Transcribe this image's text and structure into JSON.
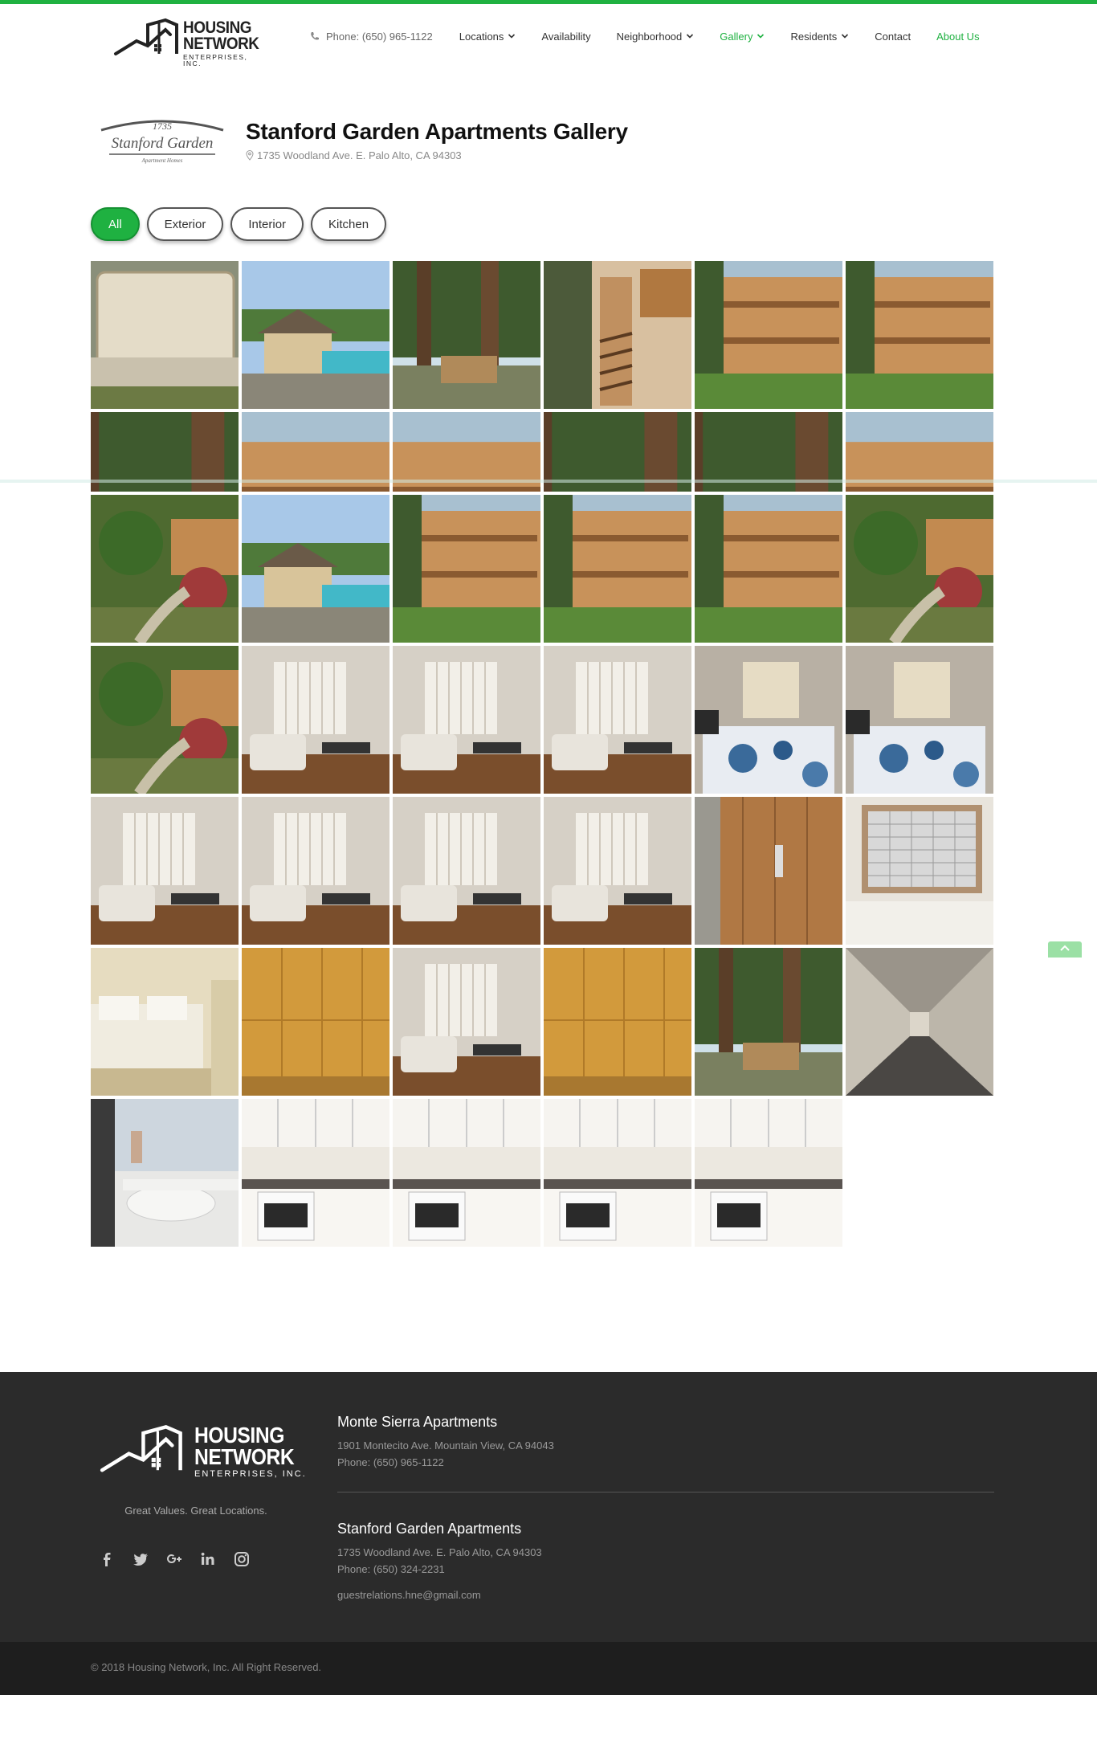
{
  "header": {
    "brand": {
      "line1": "HOUSING",
      "line2": "NETWORK",
      "line3": "ENTERPRISES, INC."
    },
    "phone": "Phone: (650) 965-1122",
    "nav": [
      {
        "label": "Locations",
        "dropdown": true,
        "active": false
      },
      {
        "label": "Availability",
        "dropdown": false,
        "active": false
      },
      {
        "label": "Neighborhood",
        "dropdown": true,
        "active": false
      },
      {
        "label": "Gallery",
        "dropdown": true,
        "active": true
      },
      {
        "label": "Residents",
        "dropdown": true,
        "active": false
      },
      {
        "label": "Contact",
        "dropdown": false,
        "active": false
      },
      {
        "label": "About Us",
        "dropdown": false,
        "active": true
      }
    ],
    "accent_color": "#1fb141"
  },
  "property": {
    "logo": {
      "number": "1735",
      "name": "Stanford Garden",
      "sub": "Apartment Homes"
    },
    "title": "Stanford Garden Apartments Gallery",
    "address": "1735 Woodland Ave. E. Palo Alto, CA 94303"
  },
  "filters": [
    {
      "label": "All",
      "active": true
    },
    {
      "label": "Exterior",
      "active": false
    },
    {
      "label": "Interior",
      "active": false
    },
    {
      "label": "Kitchen",
      "active": false
    }
  ],
  "gallery": {
    "photos": [
      {
        "name": "sign",
        "theme": "sign"
      },
      {
        "name": "pool-gazebo",
        "theme": "pool"
      },
      {
        "name": "courtyard-trees",
        "theme": "trees"
      },
      {
        "name": "stairs",
        "theme": "stairs"
      },
      {
        "name": "building-balconies",
        "theme": "building"
      },
      {
        "name": "building-balconies-2",
        "theme": "building"
      },
      {
        "name": "tall-trees",
        "theme": "trees"
      },
      {
        "name": "building-redwood",
        "theme": "building"
      },
      {
        "name": "balconies-redwood",
        "theme": "building"
      },
      {
        "name": "walkway-trees",
        "theme": "trees"
      },
      {
        "name": "courtyard-green",
        "theme": "trees"
      },
      {
        "name": "building-corner",
        "theme": "building"
      },
      {
        "name": "garden-path",
        "theme": "garden"
      },
      {
        "name": "pool-umbrellas",
        "theme": "pool"
      },
      {
        "name": "building-sky",
        "theme": "building"
      },
      {
        "name": "carport-walk",
        "theme": "building"
      },
      {
        "name": "driveway",
        "theme": "building"
      },
      {
        "name": "garden-building",
        "theme": "garden"
      },
      {
        "name": "garden-maple",
        "theme": "garden"
      },
      {
        "name": "hallway-room",
        "theme": "interior"
      },
      {
        "name": "living-room-blinds",
        "theme": "interior"
      },
      {
        "name": "living-room-balcony",
        "theme": "interior"
      },
      {
        "name": "bedroom-lamp",
        "theme": "bedroom"
      },
      {
        "name": "bedroom-floral",
        "theme": "bedroom"
      },
      {
        "name": "living-white-sofas",
        "theme": "interior"
      },
      {
        "name": "dining-kitchen",
        "theme": "interior"
      },
      {
        "name": "living-blue-sofa",
        "theme": "interior"
      },
      {
        "name": "kitchen-dining",
        "theme": "interior"
      },
      {
        "name": "elevator",
        "theme": "wood"
      },
      {
        "name": "mailboxes",
        "theme": "mailbox"
      },
      {
        "name": "laundry",
        "theme": "laundry"
      },
      {
        "name": "storage-lockers",
        "theme": "lockers"
      },
      {
        "name": "living-chair",
        "theme": "interior"
      },
      {
        "name": "bathroom-toilet",
        "theme": "lockers"
      },
      {
        "name": "balcony-trees",
        "theme": "trees"
      },
      {
        "name": "corridor",
        "theme": "corridor"
      },
      {
        "name": "bathroom-vanity",
        "theme": "bath"
      },
      {
        "name": "kitchen-stove",
        "theme": "kitchen"
      },
      {
        "name": "kitchen-fridge",
        "theme": "kitchen"
      },
      {
        "name": "kitchen-sink",
        "theme": "kitchen"
      },
      {
        "name": "kitchen-stove-2",
        "theme": "kitchen"
      }
    ]
  },
  "footer": {
    "brand": {
      "line1": "HOUSING",
      "line2": "NETWORK",
      "line3": "ENTERPRISES, INC."
    },
    "tagline": "Great Values. Great Locations.",
    "socials": [
      "facebook-icon",
      "twitter-icon",
      "google-plus-icon",
      "linkedin-icon",
      "instagram-icon"
    ],
    "locations": [
      {
        "name": "Monte Sierra Apartments",
        "address": "1901 Montecito Ave. Mountain View, CA 94043",
        "phone": "Phone: (650) 965-1122"
      },
      {
        "name": "Stanford Garden Apartments",
        "address": "1735 Woodland Ave. E. Palo Alto, CA 94303",
        "phone": "Phone: (650) 324-2231"
      }
    ],
    "email": "guestrelations.hne@gmail.com",
    "copyright": "© 2018 Housing Network, Inc. All Right Reserved."
  }
}
